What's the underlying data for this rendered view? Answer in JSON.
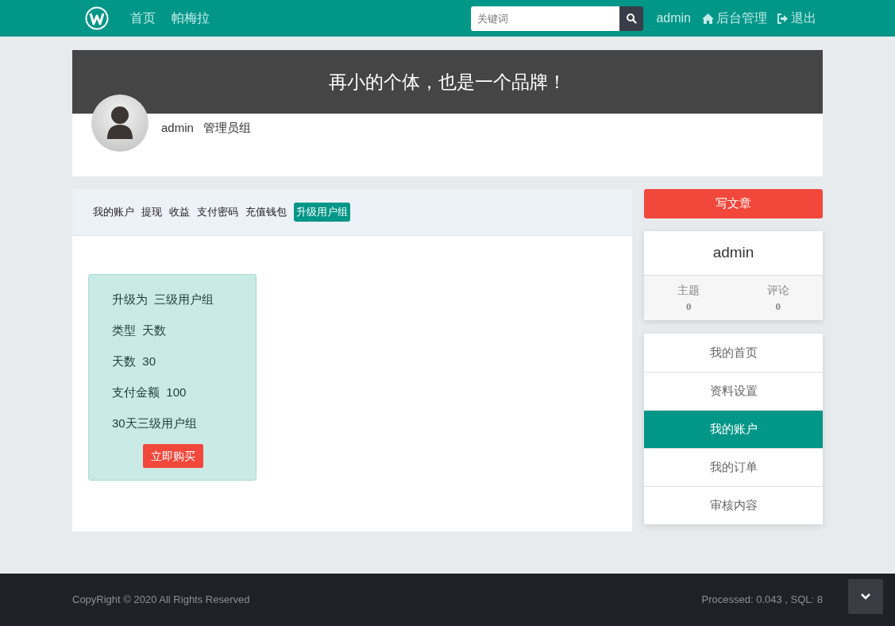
{
  "navbar": {
    "links": [
      "首页",
      "帕梅拉"
    ],
    "search": {
      "placeholder": "关键词"
    },
    "user": "admin",
    "admin_link": "后台管理",
    "logout": "退出"
  },
  "banner": {
    "slogan": "再小的个体，也是一个品牌！",
    "username": "admin",
    "group": "管理员组"
  },
  "account_tabs": [
    {
      "label": "我的账户",
      "selected": false
    },
    {
      "label": "提现",
      "selected": false
    },
    {
      "label": "收益",
      "selected": false
    },
    {
      "label": "支付密码",
      "selected": false
    },
    {
      "label": "充值钱包",
      "selected": false
    },
    {
      "label": "升级用户组",
      "selected": true
    }
  ],
  "upgrade_card": {
    "lines": [
      "升级为  三级用户组",
      "类型  天数",
      "天数  30",
      "支付金额  100",
      "30天三级用户组"
    ],
    "button": "立即购买"
  },
  "sidebar": {
    "write_button": "写文章",
    "profile": {
      "name": "admin",
      "stats": [
        {
          "label": "主题",
          "value": "0"
        },
        {
          "label": "评论",
          "value": "0"
        }
      ]
    },
    "menu": [
      {
        "label": "我的首页",
        "selected": false
      },
      {
        "label": "资料设置",
        "selected": false
      },
      {
        "label": "我的账户",
        "selected": true
      },
      {
        "label": "我的订单",
        "selected": false
      },
      {
        "label": "审核内容",
        "selected": false
      }
    ]
  },
  "footer": {
    "copyright": "CopyRight © 2020 All Rights Reserved",
    "stats": "Processed: 0.043 , SQL: 8"
  }
}
